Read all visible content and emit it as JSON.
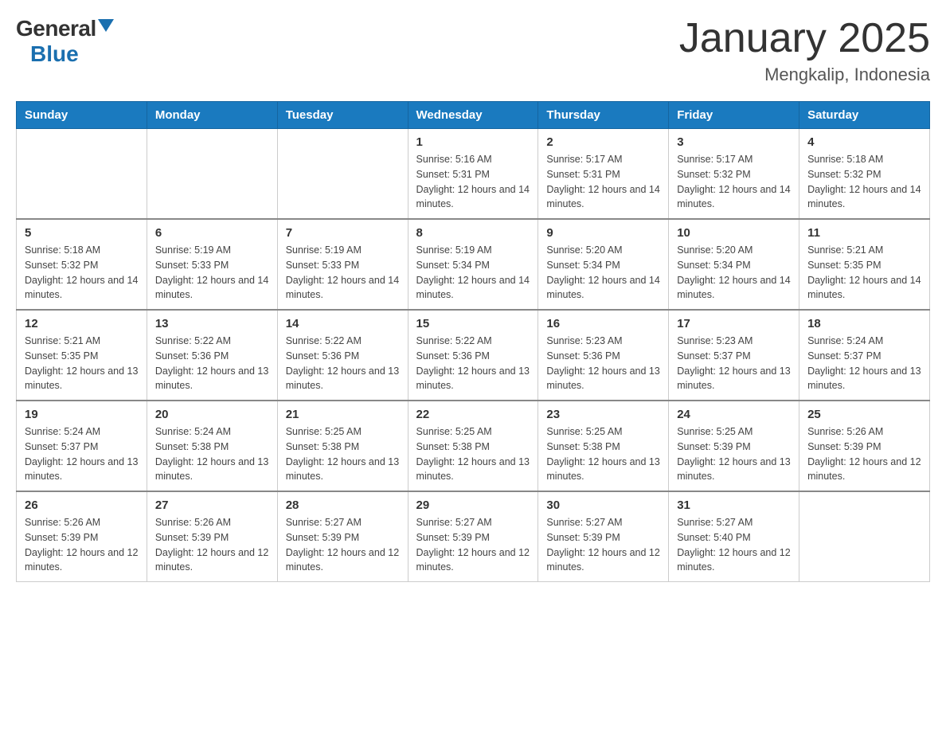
{
  "header": {
    "logo_general": "General",
    "logo_blue": "Blue",
    "month_year": "January 2025",
    "location": "Mengkalip, Indonesia"
  },
  "days_of_week": [
    "Sunday",
    "Monday",
    "Tuesday",
    "Wednesday",
    "Thursday",
    "Friday",
    "Saturday"
  ],
  "weeks": [
    [
      {
        "day": "",
        "info": ""
      },
      {
        "day": "",
        "info": ""
      },
      {
        "day": "",
        "info": ""
      },
      {
        "day": "1",
        "sunrise": "5:16 AM",
        "sunset": "5:31 PM",
        "daylight": "12 hours and 14 minutes."
      },
      {
        "day": "2",
        "sunrise": "5:17 AM",
        "sunset": "5:31 PM",
        "daylight": "12 hours and 14 minutes."
      },
      {
        "day": "3",
        "sunrise": "5:17 AM",
        "sunset": "5:32 PM",
        "daylight": "12 hours and 14 minutes."
      },
      {
        "day": "4",
        "sunrise": "5:18 AM",
        "sunset": "5:32 PM",
        "daylight": "12 hours and 14 minutes."
      }
    ],
    [
      {
        "day": "5",
        "sunrise": "5:18 AM",
        "sunset": "5:32 PM",
        "daylight": "12 hours and 14 minutes."
      },
      {
        "day": "6",
        "sunrise": "5:19 AM",
        "sunset": "5:33 PM",
        "daylight": "12 hours and 14 minutes."
      },
      {
        "day": "7",
        "sunrise": "5:19 AM",
        "sunset": "5:33 PM",
        "daylight": "12 hours and 14 minutes."
      },
      {
        "day": "8",
        "sunrise": "5:19 AM",
        "sunset": "5:34 PM",
        "daylight": "12 hours and 14 minutes."
      },
      {
        "day": "9",
        "sunrise": "5:20 AM",
        "sunset": "5:34 PM",
        "daylight": "12 hours and 14 minutes."
      },
      {
        "day": "10",
        "sunrise": "5:20 AM",
        "sunset": "5:34 PM",
        "daylight": "12 hours and 14 minutes."
      },
      {
        "day": "11",
        "sunrise": "5:21 AM",
        "sunset": "5:35 PM",
        "daylight": "12 hours and 14 minutes."
      }
    ],
    [
      {
        "day": "12",
        "sunrise": "5:21 AM",
        "sunset": "5:35 PM",
        "daylight": "12 hours and 13 minutes."
      },
      {
        "day": "13",
        "sunrise": "5:22 AM",
        "sunset": "5:36 PM",
        "daylight": "12 hours and 13 minutes."
      },
      {
        "day": "14",
        "sunrise": "5:22 AM",
        "sunset": "5:36 PM",
        "daylight": "12 hours and 13 minutes."
      },
      {
        "day": "15",
        "sunrise": "5:22 AM",
        "sunset": "5:36 PM",
        "daylight": "12 hours and 13 minutes."
      },
      {
        "day": "16",
        "sunrise": "5:23 AM",
        "sunset": "5:36 PM",
        "daylight": "12 hours and 13 minutes."
      },
      {
        "day": "17",
        "sunrise": "5:23 AM",
        "sunset": "5:37 PM",
        "daylight": "12 hours and 13 minutes."
      },
      {
        "day": "18",
        "sunrise": "5:24 AM",
        "sunset": "5:37 PM",
        "daylight": "12 hours and 13 minutes."
      }
    ],
    [
      {
        "day": "19",
        "sunrise": "5:24 AM",
        "sunset": "5:37 PM",
        "daylight": "12 hours and 13 minutes."
      },
      {
        "day": "20",
        "sunrise": "5:24 AM",
        "sunset": "5:38 PM",
        "daylight": "12 hours and 13 minutes."
      },
      {
        "day": "21",
        "sunrise": "5:25 AM",
        "sunset": "5:38 PM",
        "daylight": "12 hours and 13 minutes."
      },
      {
        "day": "22",
        "sunrise": "5:25 AM",
        "sunset": "5:38 PM",
        "daylight": "12 hours and 13 minutes."
      },
      {
        "day": "23",
        "sunrise": "5:25 AM",
        "sunset": "5:38 PM",
        "daylight": "12 hours and 13 minutes."
      },
      {
        "day": "24",
        "sunrise": "5:25 AM",
        "sunset": "5:39 PM",
        "daylight": "12 hours and 13 minutes."
      },
      {
        "day": "25",
        "sunrise": "5:26 AM",
        "sunset": "5:39 PM",
        "daylight": "12 hours and 12 minutes."
      }
    ],
    [
      {
        "day": "26",
        "sunrise": "5:26 AM",
        "sunset": "5:39 PM",
        "daylight": "12 hours and 12 minutes."
      },
      {
        "day": "27",
        "sunrise": "5:26 AM",
        "sunset": "5:39 PM",
        "daylight": "12 hours and 12 minutes."
      },
      {
        "day": "28",
        "sunrise": "5:27 AM",
        "sunset": "5:39 PM",
        "daylight": "12 hours and 12 minutes."
      },
      {
        "day": "29",
        "sunrise": "5:27 AM",
        "sunset": "5:39 PM",
        "daylight": "12 hours and 12 minutes."
      },
      {
        "day": "30",
        "sunrise": "5:27 AM",
        "sunset": "5:39 PM",
        "daylight": "12 hours and 12 minutes."
      },
      {
        "day": "31",
        "sunrise": "5:27 AM",
        "sunset": "5:40 PM",
        "daylight": "12 hours and 12 minutes."
      },
      {
        "day": "",
        "info": ""
      }
    ]
  ]
}
